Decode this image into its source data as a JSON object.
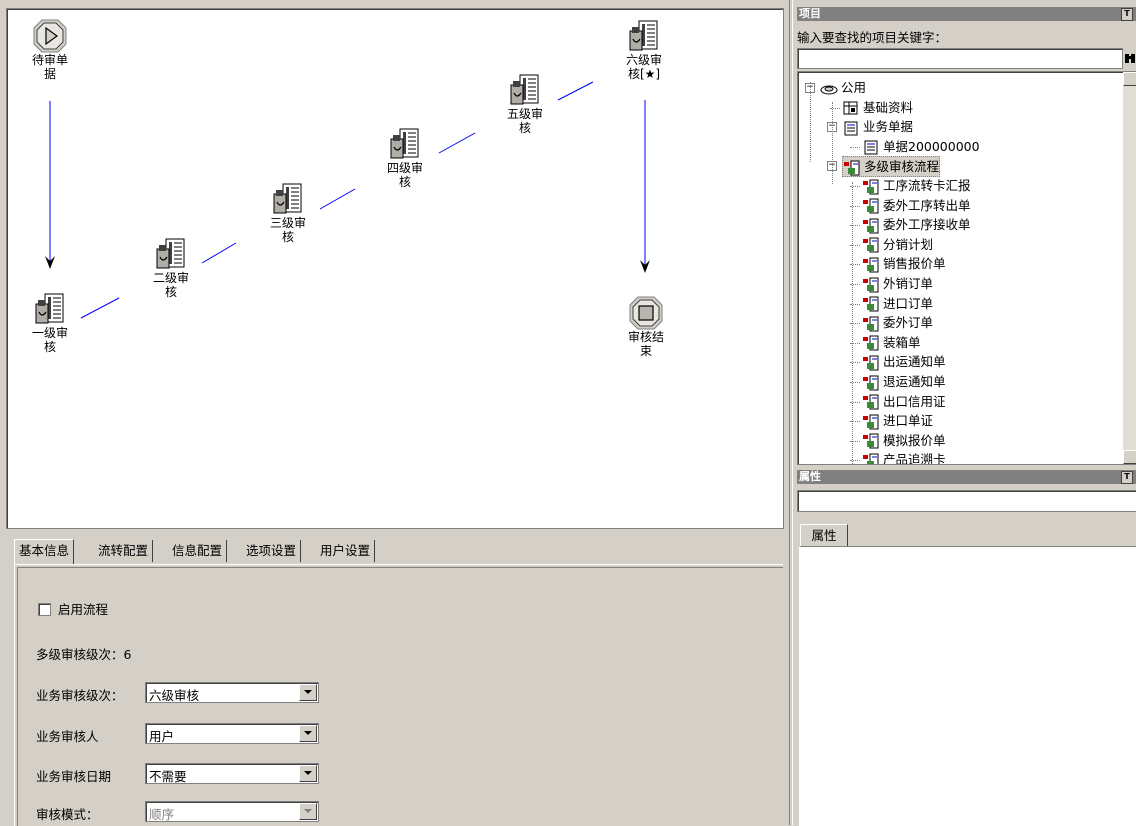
{
  "flow": {
    "nodes": [
      {
        "id": "start",
        "label": "待审单\n据",
        "icon": "start-play-icon"
      },
      {
        "id": "l1",
        "label": "一级审\n核",
        "icon": "approval-document-icon"
      },
      {
        "id": "l2",
        "label": "二级审\n核",
        "icon": "approval-document-icon"
      },
      {
        "id": "l3",
        "label": "三级审\n核",
        "icon": "approval-document-icon"
      },
      {
        "id": "l4",
        "label": "四级审\n核",
        "icon": "approval-document-icon"
      },
      {
        "id": "l5",
        "label": "五级审\n核",
        "icon": "approval-document-icon"
      },
      {
        "id": "l6",
        "label": "六级审\n核[★]",
        "icon": "approval-document-icon"
      },
      {
        "id": "end",
        "label": "审核结\n束",
        "icon": "stop-icon"
      }
    ],
    "arrow_color": "#0000ff"
  },
  "tabs": [
    "基本信息",
    "流转配置",
    "信息配置",
    "选项设置",
    "用户设置"
  ],
  "basic": {
    "enable_label": "启用流程",
    "enable_checked": false,
    "levels_label": "多级审核级次：",
    "levels_value": "6",
    "biz_level_label": "业务审核级次：",
    "biz_level_value": "六级审核",
    "approver_label": "业务审核人",
    "approver_value": "用户",
    "date_label": "业务审核日期",
    "date_value": "不需要",
    "mode_label": "审核模式：",
    "mode_value": "顺序"
  },
  "project_panel": {
    "title": "项目",
    "search_label": "输入要查找的项目关键字：",
    "search_value": "",
    "tree": [
      {
        "label": "公用",
        "icon": "public-globe-icon",
        "expanded": true
      },
      {
        "label": "基础资料",
        "icon": "basic-data-icon"
      },
      {
        "label": "业务单据",
        "icon": "document-icon",
        "expanded": true
      },
      {
        "label": "单据200000000",
        "icon": "document-icon"
      },
      {
        "label": "多级审核流程",
        "icon": "workflow-icon",
        "expanded": true,
        "selected": true
      },
      {
        "label": "工序流转卡汇报",
        "icon": "workflow-icon"
      },
      {
        "label": "委外工序转出单",
        "icon": "workflow-icon"
      },
      {
        "label": "委外工序接收单",
        "icon": "workflow-icon"
      },
      {
        "label": "分销计划",
        "icon": "workflow-icon"
      },
      {
        "label": "销售报价单",
        "icon": "workflow-icon"
      },
      {
        "label": "外销订单",
        "icon": "workflow-icon"
      },
      {
        "label": "进口订单",
        "icon": "workflow-icon"
      },
      {
        "label": "委外订单",
        "icon": "workflow-icon"
      },
      {
        "label": "装箱单",
        "icon": "workflow-icon"
      },
      {
        "label": "出运通知单",
        "icon": "workflow-icon"
      },
      {
        "label": "退运通知单",
        "icon": "workflow-icon"
      },
      {
        "label": "出口信用证",
        "icon": "workflow-icon"
      },
      {
        "label": "进口单证",
        "icon": "workflow-icon"
      },
      {
        "label": "模拟报价单",
        "icon": "workflow-icon"
      },
      {
        "label": "产品追溯卡",
        "icon": "workflow-icon"
      }
    ]
  },
  "property_panel": {
    "title": "属性",
    "combo_value": "",
    "tab_label": "属性"
  }
}
